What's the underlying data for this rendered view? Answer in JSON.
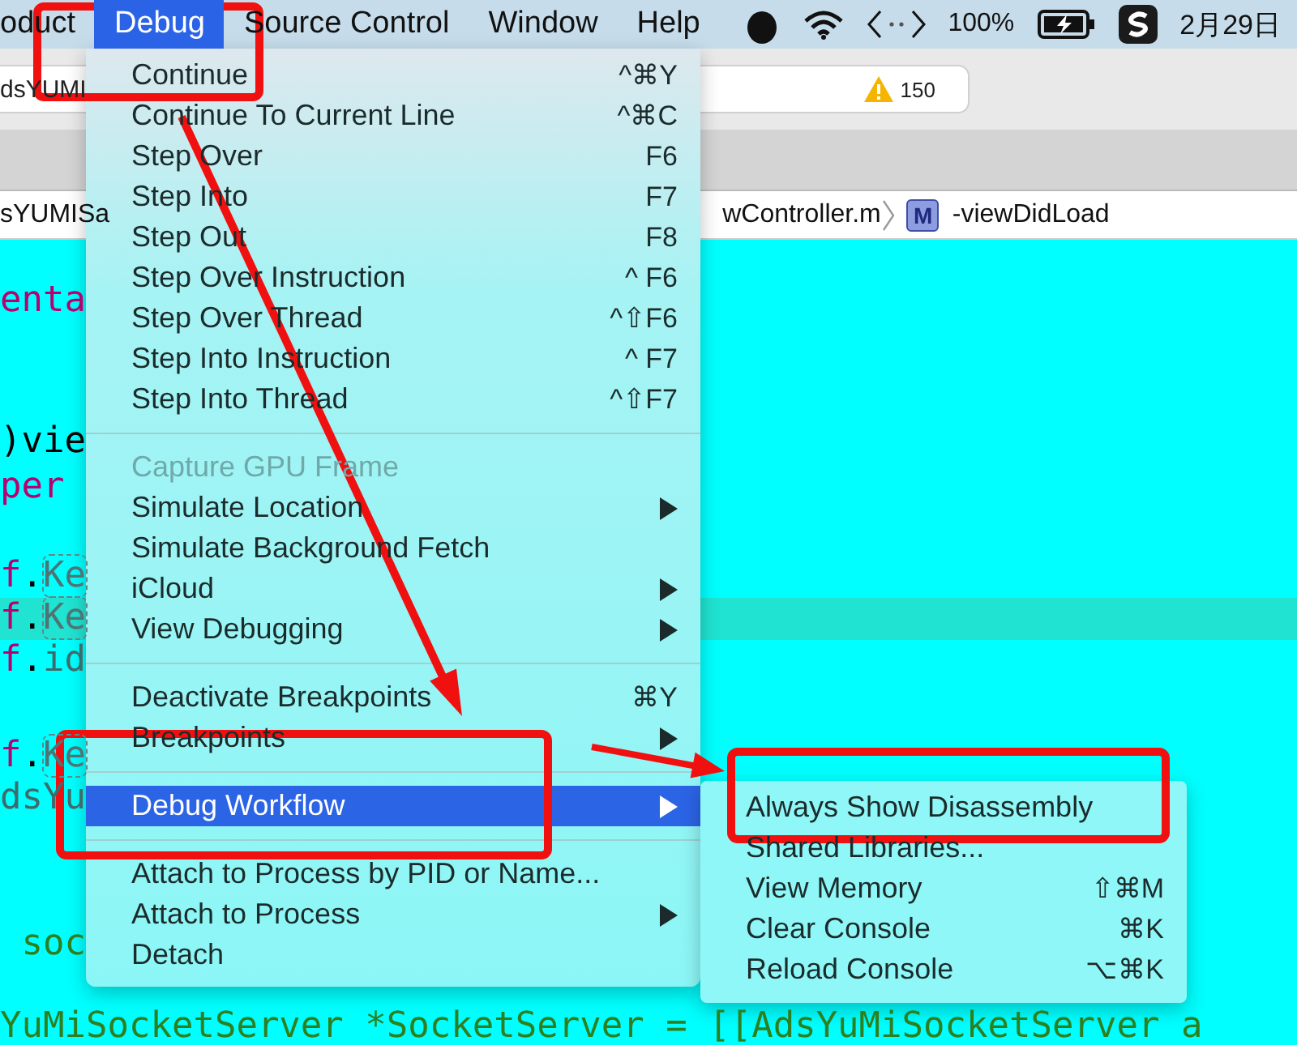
{
  "menu_bar": {
    "items": [
      {
        "label": "oduct",
        "selected": false
      },
      {
        "label": "Debug",
        "selected": true
      },
      {
        "label": "Source Control",
        "selected": false
      },
      {
        "label": "Window",
        "selected": false
      },
      {
        "label": "Help",
        "selected": false
      }
    ],
    "battery": "100%",
    "date": "2月29日"
  },
  "toolbar": {
    "scheme": "dsYUMI",
    "warning_count": "150"
  },
  "breadcrumb": {
    "project": "sYUMISa",
    "file": "wController.m",
    "method_badge": "M",
    "method": "-viewDidLoad"
  },
  "code_lines": [
    {
      "highlighted": false,
      "segments": [
        {
          "text": "enta",
          "kind": "keyword"
        }
      ]
    },
    {
      "highlighted": false,
      "segments": [
        {
          "text": ")vie",
          "kind": "plain"
        }
      ]
    },
    {
      "highlighted": false,
      "segments": [
        {
          "text": "per",
          "kind": "keyword"
        }
      ]
    },
    {
      "highlighted": false,
      "segments": [
        {
          "text": "f",
          "kind": "keyword"
        },
        {
          "text": ".",
          "kind": "plain"
        },
        {
          "text": "Ke",
          "kind": "placeholder"
        }
      ]
    },
    {
      "highlighted": true,
      "segments": [
        {
          "text": "f",
          "kind": "keyword"
        },
        {
          "text": ".",
          "kind": "plain"
        },
        {
          "text": "Ke",
          "kind": "placeholder"
        }
      ]
    },
    {
      "highlighted": false,
      "segments": [
        {
          "text": "f",
          "kind": "keyword"
        },
        {
          "text": ".",
          "kind": "plain"
        },
        {
          "text": "id",
          "kind": "ident"
        }
      ]
    },
    {
      "highlighted": false,
      "segments": [
        {
          "text": "f",
          "kind": "keyword"
        },
        {
          "text": ".",
          "kind": "plain"
        },
        {
          "text": "Ke",
          "kind": "placeholder"
        }
      ]
    },
    {
      "highlighted": false,
      "segments": [
        {
          "text": "dsYu",
          "kind": "ident"
        }
      ]
    },
    {
      "highlighted": false,
      "segments": [
        {
          "text": " soc",
          "kind": "comment"
        }
      ]
    },
    {
      "highlighted": false,
      "segments": [
        {
          "text": "YuMiSocketServer *SocketServer = [[AdsYuMiSocketServer a",
          "kind": "comment"
        }
      ]
    }
  ],
  "debug_menu": {
    "items": [
      {
        "kind": "item",
        "label": "Continue",
        "shortcut": "^⌘Y",
        "submenu": false,
        "disabled": false,
        "selected": false
      },
      {
        "kind": "item",
        "label": "Continue To Current Line",
        "shortcut": "^⌘C",
        "submenu": false,
        "disabled": false,
        "selected": false
      },
      {
        "kind": "item",
        "label": "Step Over",
        "shortcut": "F6",
        "submenu": false,
        "disabled": false,
        "selected": false
      },
      {
        "kind": "item",
        "label": "Step Into",
        "shortcut": "F7",
        "submenu": false,
        "disabled": false,
        "selected": false
      },
      {
        "kind": "item",
        "label": "Step Out",
        "shortcut": "F8",
        "submenu": false,
        "disabled": false,
        "selected": false
      },
      {
        "kind": "item",
        "label": "Step Over Instruction",
        "shortcut": "^ F6",
        "submenu": false,
        "disabled": false,
        "selected": false
      },
      {
        "kind": "item",
        "label": "Step Over Thread",
        "shortcut": "^⇧F6",
        "submenu": false,
        "disabled": false,
        "selected": false
      },
      {
        "kind": "item",
        "label": "Step Into Instruction",
        "shortcut": "^ F7",
        "submenu": false,
        "disabled": false,
        "selected": false
      },
      {
        "kind": "item",
        "label": "Step Into Thread",
        "shortcut": "^⇧F7",
        "submenu": false,
        "disabled": false,
        "selected": false
      },
      {
        "kind": "separator"
      },
      {
        "kind": "item",
        "label": "Capture GPU Frame",
        "submenu": false,
        "disabled": true,
        "selected": false
      },
      {
        "kind": "item",
        "label": "Simulate Location",
        "submenu": true,
        "disabled": false,
        "selected": false
      },
      {
        "kind": "item",
        "label": "Simulate Background Fetch",
        "submenu": false,
        "disabled": false,
        "selected": false
      },
      {
        "kind": "item",
        "label": "iCloud",
        "submenu": true,
        "disabled": false,
        "selected": false
      },
      {
        "kind": "item",
        "label": "View Debugging",
        "submenu": true,
        "disabled": false,
        "selected": false
      },
      {
        "kind": "separator"
      },
      {
        "kind": "item",
        "label": "Deactivate Breakpoints",
        "shortcut": "⌘Y",
        "submenu": false,
        "disabled": false,
        "selected": false
      },
      {
        "kind": "item",
        "label": "Breakpoints",
        "submenu": true,
        "disabled": false,
        "selected": false
      },
      {
        "kind": "separator"
      },
      {
        "kind": "item",
        "label": "Debug Workflow",
        "submenu": true,
        "disabled": false,
        "selected": true
      },
      {
        "kind": "separator"
      },
      {
        "kind": "item",
        "label": "Attach to Process by PID or Name...",
        "submenu": false,
        "disabled": false,
        "selected": false
      },
      {
        "kind": "item",
        "label": "Attach to Process",
        "submenu": true,
        "disabled": false,
        "selected": false
      },
      {
        "kind": "item",
        "label": "Detach",
        "submenu": false,
        "disabled": false,
        "selected": false
      }
    ]
  },
  "workflow_submenu": {
    "items": [
      {
        "kind": "item",
        "label": "Always Show Disassembly",
        "submenu": false,
        "disabled": false,
        "selected": false
      },
      {
        "kind": "item",
        "label": "Shared Libraries...",
        "submenu": false,
        "disabled": false,
        "selected": false
      },
      {
        "kind": "item",
        "label": "View Memory",
        "shortcut": "⇧⌘M",
        "submenu": false,
        "disabled": false,
        "selected": false
      },
      {
        "kind": "item",
        "label": "Clear Console",
        "shortcut": "⌘K",
        "submenu": false,
        "disabled": false,
        "selected": false
      },
      {
        "kind": "item",
        "label": "Reload Console",
        "shortcut": "⌥⌘K",
        "submenu": false,
        "disabled": false,
        "selected": false
      }
    ]
  }
}
